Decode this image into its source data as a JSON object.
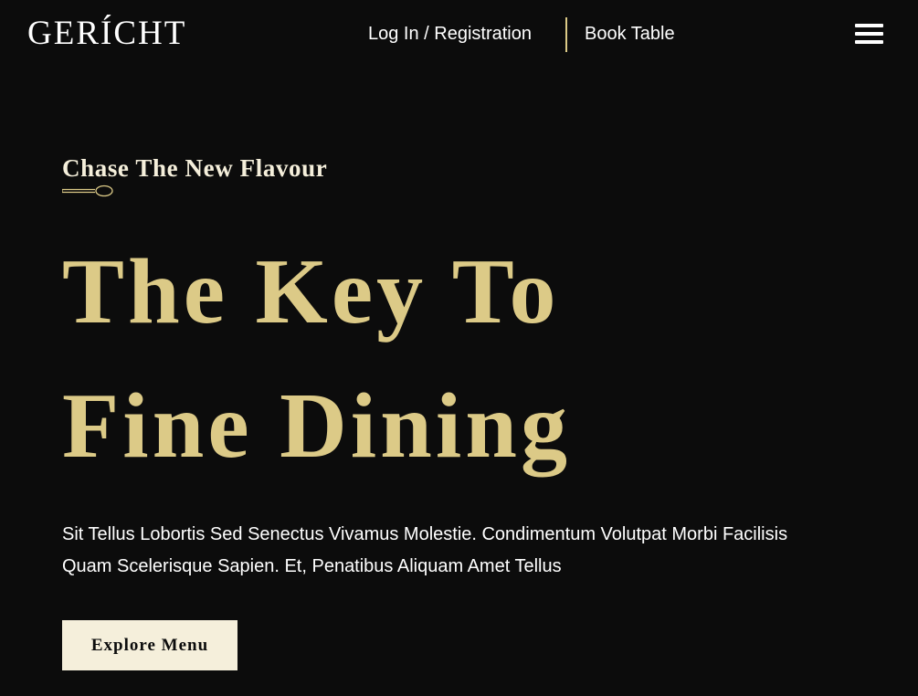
{
  "navbar": {
    "logo": "GERÍCHT",
    "login_label": "Log In / Registration",
    "book_label": "Book Table",
    "menu_icon": "hamburger-menu-icon"
  },
  "hero": {
    "subtitle": "Chase The New Flavour",
    "decor_icon": "spoon-icon",
    "headline_line1": "The Key To",
    "headline_line2": "Fine Dining",
    "description": "Sit Tellus Lobortis Sed Senectus Vivamus Molestie. Condimentum Volutpat Morbi Facilisis Quam Scelerisque Sapien. Et, Penatibus Aliquam Amet Tellus",
    "cta_label": "Explore Menu"
  },
  "colors": {
    "background": "#0c0c0c",
    "gold": "#dcca87",
    "crimson": "#f5efdb",
    "white": "#ffffff"
  }
}
